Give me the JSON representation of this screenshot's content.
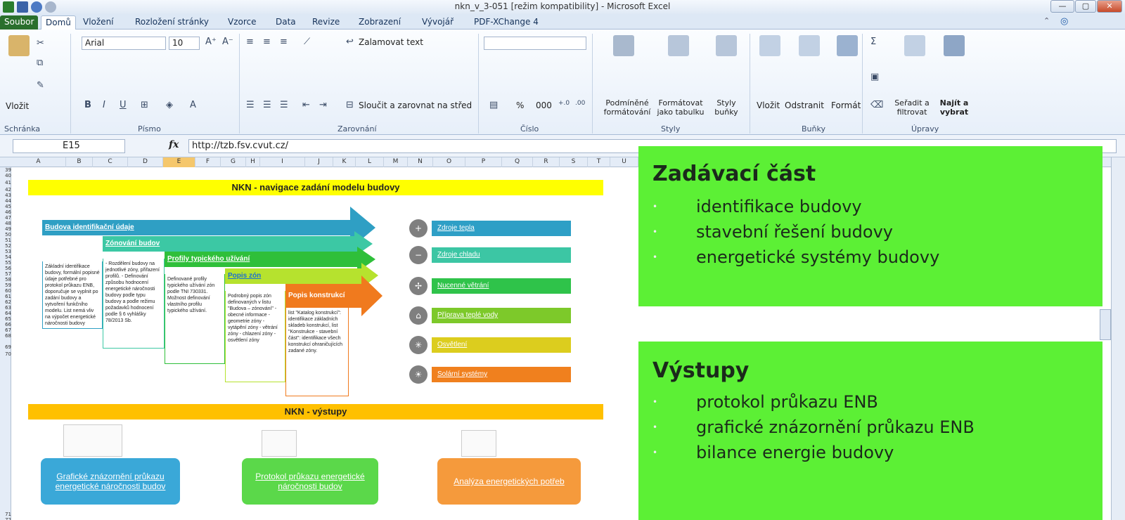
{
  "window": {
    "title": "nkn_v_3-051  [režim kompatibility] - Microsoft Excel"
  },
  "ribbon_tabs": [
    "Soubor",
    "Domů",
    "Vložení",
    "Rozložení stránky",
    "Vzorce",
    "Data",
    "Revize",
    "Zobrazení",
    "Vývojář",
    "PDF-XChange 4"
  ],
  "ribbon": {
    "paste_label": "Vložit",
    "font_name": "Arial",
    "font_size": "10",
    "wrap_text": "Zalamovat text",
    "merge_center": "Sloučit a zarovnat na střed",
    "percent": "%",
    "thousands": "000",
    "cond_format": "Podmíněné formátování",
    "format_table": "Formátovat jako tabulku",
    "cell_styles": "Styly buňky",
    "insert": "Vložit",
    "delete": "Odstranit",
    "format": "Formát",
    "sort_filter": "Seřadit a filtrovat",
    "find_select": "Najít a vybrat",
    "groups": [
      "Schránka",
      "Písmo",
      "Zarovnání",
      "Číslo",
      "Styly",
      "Buňky",
      "Úpravy"
    ]
  },
  "formula_bar": {
    "name_box": "E15",
    "fx": "fx",
    "value": "http://tzb.fsv.cvut.cz/"
  },
  "columns": [
    "A",
    "B",
    "C",
    "D",
    "E",
    "F",
    "G",
    "H",
    "I",
    "J",
    "K",
    "L",
    "M",
    "N",
    "O",
    "P",
    "Q",
    "R",
    "S",
    "T",
    "U"
  ],
  "rows": [
    "39",
    "40",
    "41",
    "42",
    "43",
    "44",
    "45",
    "46",
    "47",
    "48",
    "49",
    "50",
    "51",
    "52",
    "53",
    "54",
    "55",
    "56",
    "57",
    "58",
    "59",
    "60",
    "61",
    "62",
    "63",
    "64",
    "65",
    "66",
    "67",
    "68",
    "69",
    "70",
    "71",
    "72"
  ],
  "sheet": {
    "nav_title": "NKN - navigace zadání modelu budovy",
    "arrows": [
      "Budova identifikační údaje",
      "Zónování budov",
      "Profily typického užívání",
      "Popis zón",
      "Popis konstrukcí"
    ],
    "descriptions": [
      "Základní identifikace budovy, formální popisné údaje potřebné pro protokol průkazu ENB, doporučuje se vyplnit po zadání budovy a vytvoření funkčního modelu. List nemá vliv na výpočet energetické náročnosti budovy",
      "- Rozdělení budovy na jednotlivé zóny, přiřazení profilů. - Definování způsobu hodnocení energetické náročnosti budovy podle typu budovy a podle režimu požadavků hodnocení podle § 6 vyhlášky 78/2013 Sb.",
      "Definované profily typického užívání zón podle TNI 730331. Možnost definování vlastního profilu typického užívání.",
      "Podrobný popis zón definovaných v listu \"Budova – zónování\" - obecné informace - geometrie zóny - vytápění zóny - větrání zóny - chlazení zóny - osvětlení zóny",
      "list \"Katalog konstrukcí\": identifikace základních skladeb konstrukcí, list \"Konstrukce - stavební část\": identifikace všech konstrukcí ohraničujících zadané zóny."
    ],
    "systems": [
      {
        "label": "Zdroje tepla",
        "icon": "thermometer-hot-icon",
        "symbol": "+",
        "color": "#2e9fc6"
      },
      {
        "label": "Zdroje chladu",
        "icon": "thermometer-cold-icon",
        "symbol": "−",
        "color": "#3cc6a4"
      },
      {
        "label": "Nucenné větrání",
        "icon": "fan-icon",
        "symbol": "✢",
        "color": "#2fc34a"
      },
      {
        "label": "Příprava teplé vody",
        "icon": "tap-icon",
        "symbol": "⌂",
        "color": "#7dc92a"
      },
      {
        "label": "Osvětlení",
        "icon": "bulb-icon",
        "symbol": "✳",
        "color": "#dccd1e"
      },
      {
        "label": "Solární systémy",
        "icon": "sun-icon",
        "symbol": "☀",
        "color": "#f0801e"
      }
    ],
    "outputs_title": "NKN - výstupy",
    "outputs": [
      {
        "label": "Grafické znázornění průkazu energetické náročnosti budov",
        "color": "#3aa8d8"
      },
      {
        "label": "Protokol průkazu energetické náročnosti budov",
        "color": "#5bd84a"
      },
      {
        "label": "Analýza energetických potřeb",
        "color": "#f59a3c"
      }
    ]
  },
  "callouts": {
    "input": {
      "heading": "Zadávací část",
      "items": [
        "identifikace budovy",
        "stavební řešení budovy",
        "energetické systémy budovy"
      ]
    },
    "output": {
      "heading": "Výstupy",
      "items": [
        "protokol průkazu ENB",
        "grafické znázornění průkazu ENB",
        "bilance energie budovy"
      ]
    }
  },
  "colors": {
    "callout_green": "#5cf035",
    "nav_yellow": "#ffff00",
    "outputs_orange": "#ffc000",
    "file_tab": "#2a6f2d"
  }
}
